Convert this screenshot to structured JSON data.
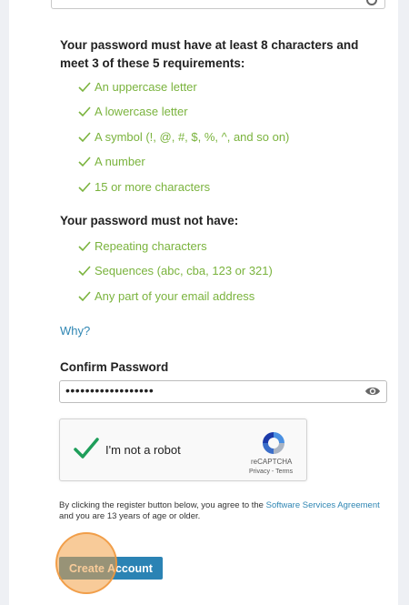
{
  "requirements": {
    "title": "Your password must have at least 8 characters and meet 3 of these 5 requirements:",
    "items": [
      "An uppercase letter",
      "A lowercase letter",
      "A symbol (!, @, #, $, %, ^, and so on)",
      "A number",
      "15 or more characters"
    ]
  },
  "prohibitions": {
    "title": "Your password must not have:",
    "items": [
      "Repeating characters",
      "Sequences (abc, cba, 123 or 321)",
      "Any part of your email address"
    ]
  },
  "why_link": "Why?",
  "confirm_password": {
    "label": "Confirm Password",
    "value": "••••••••••••••••••"
  },
  "captcha": {
    "label": "I'm not a robot",
    "brand": "reCAPTCHA",
    "privacy": "Privacy",
    "separator": " - ",
    "terms": "Terms",
    "checked": true
  },
  "agreement": {
    "prefix": "By clicking the register button below, you agree to the ",
    "link": "Software Services Agreement",
    "suffix": " and you are 13 years of age or older."
  },
  "create_button": "Create Account",
  "colors": {
    "check_green": "#7ab33d",
    "link_blue": "#2f86b3",
    "button_blue": "#2b83b4",
    "click_highlight": "#f3a046"
  }
}
